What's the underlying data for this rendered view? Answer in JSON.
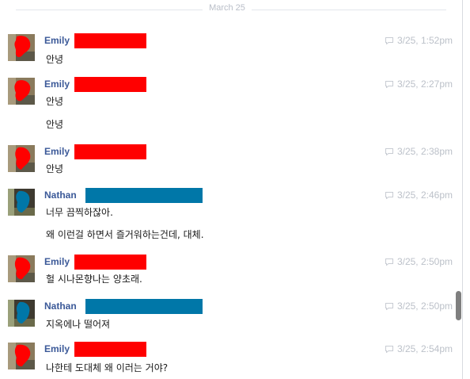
{
  "date_divider": "March 25",
  "colors": {
    "emily_redact": "#ff0000",
    "nathan_redact": "#0077a8",
    "sender_link": "#3b5998",
    "timestamp": "#bcc1c9"
  },
  "groups": [
    {
      "sender": "Emily",
      "avatar": "redacted-photo-red",
      "time": "3/25, 1:52pm",
      "lines": [
        "안녕"
      ]
    },
    {
      "sender": "Emily",
      "avatar": "redacted-photo-red",
      "time": "3/25, 2:27pm",
      "lines": [
        "안녕",
        "안녕"
      ]
    },
    {
      "sender": "Emily",
      "avatar": "redacted-photo-red",
      "time": "3/25, 2:38pm",
      "lines": [
        "안녕"
      ]
    },
    {
      "sender": "Nathan",
      "avatar": "redacted-photo-blue",
      "time": "3/25, 2:46pm",
      "lines": [
        "너무 끔찍하잖아.",
        "왜 이런걸 하면서 즐거워하는건데, 대체."
      ]
    },
    {
      "sender": "Emily",
      "avatar": "redacted-photo-red",
      "time": "3/25, 2:50pm",
      "lines": [
        "헐 시나몬향나는 양초래."
      ]
    },
    {
      "sender": "Nathan",
      "avatar": "redacted-photo-blue",
      "time": "3/25, 2:50pm",
      "lines": [
        "지옥에나 떨어져"
      ]
    },
    {
      "sender": "Emily",
      "avatar": "redacted-photo-red",
      "time": "3/25, 2:54pm",
      "lines": [
        "나한테 도대체 왜 이러는 거야?"
      ]
    }
  ]
}
